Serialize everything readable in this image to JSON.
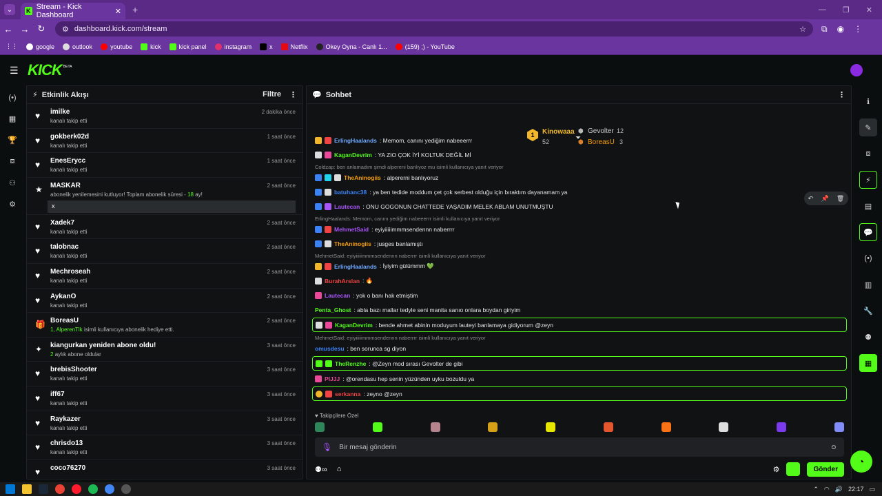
{
  "browser": {
    "tab_title": "Stream - Kick Dashboard",
    "url": "dashboard.kick.com/stream",
    "bookmarks": [
      "google",
      "outlook",
      "youtube",
      "kick",
      "kick panel",
      "instagram",
      "x",
      "Netflix",
      "Okey Oyna - Canlı 1...",
      "(159) ;) - YouTube"
    ]
  },
  "app": {
    "logo": "KICK",
    "beta": "BETA"
  },
  "activity": {
    "title": "Etkinlik Akışı",
    "filter": "Filtre",
    "events": [
      {
        "name": "imilke",
        "sub": "kanalı takip etti",
        "time": "2 dakika önce",
        "icon": "♥"
      },
      {
        "name": "gokberk02d",
        "sub": "kanalı takip etti",
        "time": "1 saat önce",
        "icon": "♥"
      },
      {
        "name": "EnesErycc",
        "sub": "kanalı takip etti",
        "time": "1 saat önce",
        "icon": "♥"
      },
      {
        "name": "Xadek7",
        "sub": "kanalı takip etti",
        "time": "2 saat önce",
        "icon": "♥"
      },
      {
        "name": "talobnac",
        "sub": "kanalı takip etti",
        "time": "2 saat önce",
        "icon": "♥"
      },
      {
        "name": "Mechroseah",
        "sub": "kanalı takip etti",
        "time": "2 saat önce",
        "icon": "♥"
      },
      {
        "name": "AykanO",
        "sub": "kanalı takip etti",
        "time": "2 saat önce",
        "icon": "♥"
      }
    ],
    "resub": {
      "name": "MASKAR",
      "text": "abonelik yenilemesini kutluyor! Toplam abonelik süresi -",
      "months": "18",
      "unit": "ay!",
      "time": "2 saat önce",
      "message": "x"
    },
    "gift": {
      "name": "BoreasU",
      "prefix": "1,",
      "user": "AlperenTlk",
      "text": "isimli kullanıcıya abonelik hediye etti.",
      "time": "2 saat önce"
    },
    "resub2": {
      "name": "kiangurkan yeniden abone oldu!",
      "prefix": "2",
      "text": "aylık abone oldular",
      "time": "3 saat önce"
    },
    "events2": [
      {
        "name": "brebisShooter",
        "sub": "kanalı takip etti",
        "time": "3 saat önce"
      },
      {
        "name": "iff67",
        "sub": "kanalı takip etti",
        "time": "3 saat önce"
      },
      {
        "name": "Raykazer",
        "sub": "kanalı takip etti",
        "time": "3 saat önce"
      },
      {
        "name": "chrisdo13",
        "sub": "kanalı takip etti",
        "time": "3 saat önce"
      },
      {
        "name": "coco76270",
        "sub": "",
        "time": "3 saat önce"
      }
    ]
  },
  "chat": {
    "title": "Sohbet",
    "leaderboard": {
      "first": {
        "name": "Kinowaaa",
        "score": "52",
        "rank": "1"
      },
      "second": {
        "name": "Gevolter",
        "score": "12"
      },
      "third": {
        "name": "BoreasU",
        "score": "3"
      }
    },
    "messages": [
      {
        "type": "msg",
        "user": "ErlingHaalands",
        "color": "#6fa8ff",
        "text": ": Memom, canını yediğim nabeeerrr"
      },
      {
        "type": "msg",
        "user": "KaganDevrim",
        "color": "#53fc18",
        "text": ": YA ZIO ÇOK İYİ KOLTUK DEĞİL Mİ"
      },
      {
        "type": "reply",
        "text": "Coldzap: ben anlamadım şimdi alpereni banlıyoz mu isimli kullanıcıya yanıt veriyor"
      },
      {
        "type": "msg",
        "user": "TheAninogiis",
        "color": "#f59e0b",
        "text": ": alpererni banlıyoruz"
      },
      {
        "type": "msg",
        "user": "batuhanc38",
        "color": "#3b82f6",
        "text": ": ya ben tedide moddum çet çok serbest olduğu için bıraktım dayanamam ya"
      },
      {
        "type": "msg",
        "user": "Lautecan",
        "color": "#a855f7",
        "text": ": ONU GOGONUN CHATTEDE YAŞADIM MELEK ABLAM UNUTMUŞTU"
      },
      {
        "type": "reply",
        "text": "ErlingHaalands: Memom, canını yediğim nabeeerrr isimli kullanıcıya yanıt veriyor"
      },
      {
        "type": "msg",
        "user": "MehmetSaid",
        "color": "#a855f7",
        "text": ": eyiyiiiiimmmsendennn naberrrr"
      },
      {
        "type": "msg",
        "user": "TheAninogiis",
        "color": "#f59e0b",
        "text": ": jusges banlamıştı"
      },
      {
        "type": "reply",
        "text": "MehmetSaid: eyiyiiiiimmmsendennn naberrrr isimli kullanıcıya yanıt veriyor"
      },
      {
        "type": "msg",
        "user": "ErlingHaalands",
        "color": "#6fa8ff",
        "text": ": İyiyim gülümmm 💚"
      },
      {
        "type": "msg",
        "user": "BurahArslan",
        "color": "#ef4444",
        "text": ": 🔥"
      },
      {
        "type": "msg",
        "user": "Lautecan",
        "color": "#a855f7",
        "text": ": yok o banı hak etmiştim"
      },
      {
        "type": "msg",
        "user": "Penta_Ghost",
        "color": "#53fc18",
        "text": ": abla bazı mallar tedyle seni manita sanıo onlara boydan giriyim"
      },
      {
        "type": "hl",
        "user": "KaganDevrim",
        "color": "#53fc18",
        "text": ": bende ahmet abinin moduyum lauteyi banlamaya gidiyorum @zeyn"
      },
      {
        "type": "reply",
        "text": "MehmetSaid: eyiyiiiiimmmsendennn naberrrr isimli kullanıcıya yanıt veriyor"
      },
      {
        "type": "msg",
        "user": "omusdesu",
        "color": "#3b82f6",
        "text": ": ben sorunca sg diyon"
      },
      {
        "type": "hl",
        "user": "TheRenzhe",
        "color": "#53fc18",
        "text": ": @Zeyn mod sırası Gevolter de gibi"
      },
      {
        "type": "msg",
        "user": "PIJJJ",
        "color": "#ec4899",
        "text": ": @orendasu hep senin yüzünden uyku bozuldu ya"
      },
      {
        "type": "hl",
        "user": "serkanna",
        "color": "#ef4444",
        "text": ": zeyno @zeyn"
      }
    ],
    "followers_label": "Takipçilere Özel",
    "input_placeholder": "Bir mesaj gönderin",
    "send_label": "Gönder"
  },
  "taskbar": {
    "time": "22:17"
  }
}
